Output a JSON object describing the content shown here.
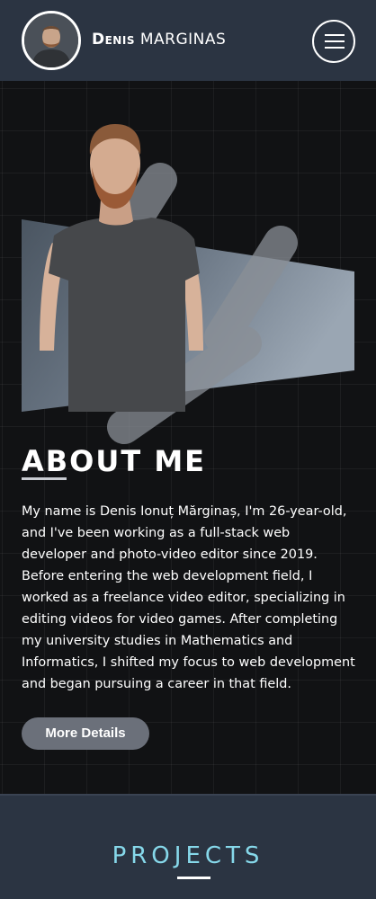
{
  "header": {
    "name_first": "Denis",
    "name_last": "MARGINAS",
    "avatar_icon": "person-avatar",
    "menu_icon": "hamburger-menu-icon"
  },
  "about": {
    "title": "ABOUT ME",
    "body": "My name is Denis Ionuț Mărginaș, I'm 26-year-old, and I've been working as a full-stack web developer and photo-video editor since 2019. Before entering the web development field, I worked as a freelance video editor, specializing in editing videos for video games. After completing my university studies in Mathematics and Informatics, I shifted my focus to web development and began pursuing a career in that field.",
    "button_label": "More Details"
  },
  "projects": {
    "title": "PROJECTS"
  },
  "colors": {
    "header_bg": "#2b3442",
    "page_bg": "#111214",
    "accent_cyan": "#86d8ea",
    "button_bg": "#6b707a"
  }
}
